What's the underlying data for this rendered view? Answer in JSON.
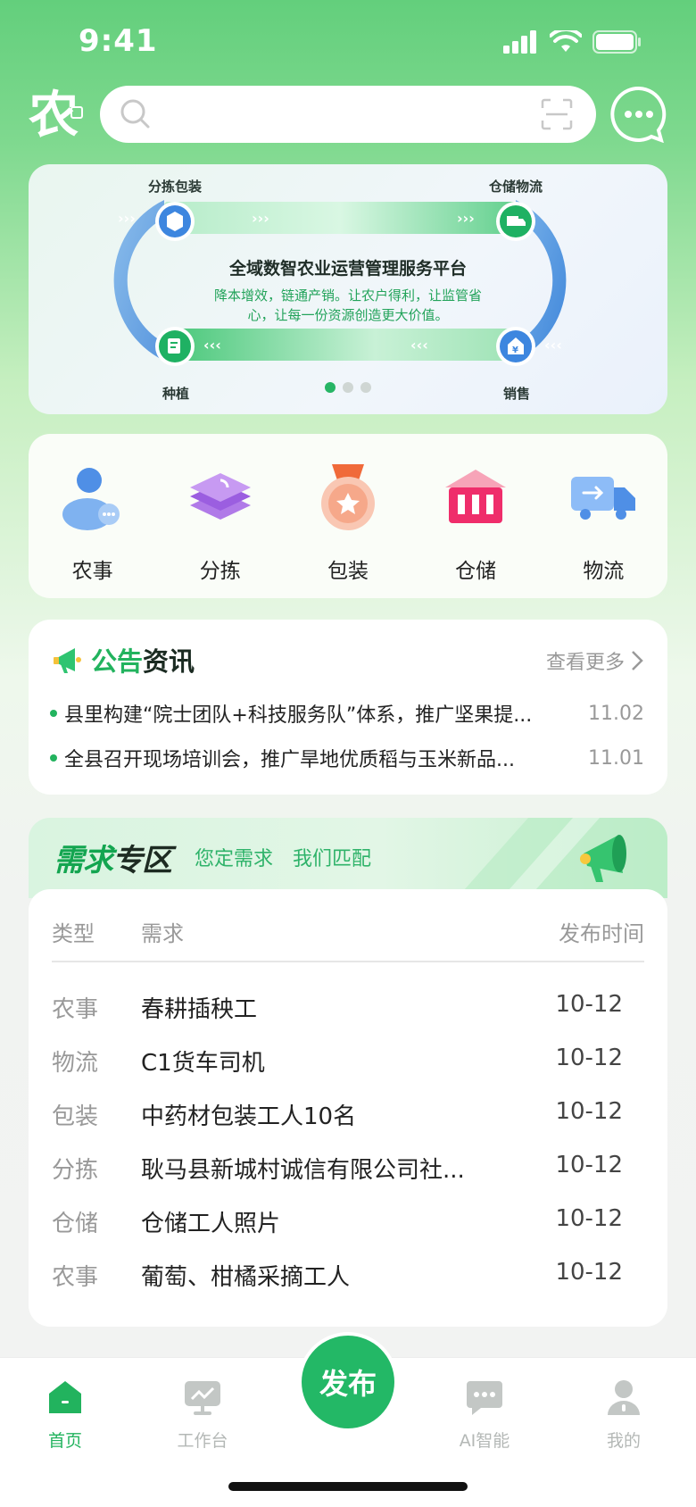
{
  "status_bar": {
    "time": "9:41"
  },
  "header": {
    "logo_char": "农",
    "search_placeholder": ""
  },
  "banner": {
    "title": "全域数智农业运营管理服务平台",
    "subtitle": "降本增效，链通产销。让农户得利，让监管省心，让每一份资源创造更大价值。",
    "nodes": [
      "分拣包装",
      "仓储物流",
      "种植",
      "销售"
    ],
    "active_dot": 0,
    "dot_count": 3
  },
  "categories": [
    {
      "label": "农事",
      "icon": "farmer-icon"
    },
    {
      "label": "分拣",
      "icon": "layers-icon"
    },
    {
      "label": "包装",
      "icon": "medal-icon"
    },
    {
      "label": "仓储",
      "icon": "warehouse-icon"
    },
    {
      "label": "物流",
      "icon": "truck-icon"
    }
  ],
  "notice": {
    "title_a": "公告",
    "title_b": "资讯",
    "more": "查看更多",
    "items": [
      {
        "text": "县里构建“院士团队+科技服务队”体系，推广坚果提...",
        "date": "11.02"
      },
      {
        "text": "全县召开现场培训会，推广旱地优质稻与玉米新品...",
        "date": "11.01"
      }
    ]
  },
  "demand": {
    "title_a": "需求",
    "title_b": "专区",
    "slogan": "您定需求　我们匹配",
    "headers": {
      "type": "类型",
      "need": "需求",
      "time": "发布时间"
    },
    "rows": [
      {
        "type": "农事",
        "need": "春耕插秧工",
        "time": "10-12"
      },
      {
        "type": "物流",
        "need": "C1货车司机",
        "time": "10-12"
      },
      {
        "type": "包装",
        "need": "中药材包装工人10名",
        "time": "10-12"
      },
      {
        "type": "分拣",
        "need": "耿马县新城村诚信有限公司社...",
        "time": "10-12"
      },
      {
        "type": "仓储",
        "need": "仓储工人照片",
        "time": "10-12"
      },
      {
        "type": "农事",
        "need": "葡萄、柑橘采摘工人",
        "time": "10-12"
      }
    ]
  },
  "tabbar": {
    "items": [
      {
        "label": "首页",
        "active": true
      },
      {
        "label": "工作台",
        "active": false
      },
      {
        "label": "AI智能",
        "active": false
      },
      {
        "label": "我的",
        "active": false
      }
    ],
    "publish": "发布"
  },
  "colors": {
    "brand_green": "#22b35e",
    "banner_blue": "#4a8fe0"
  }
}
